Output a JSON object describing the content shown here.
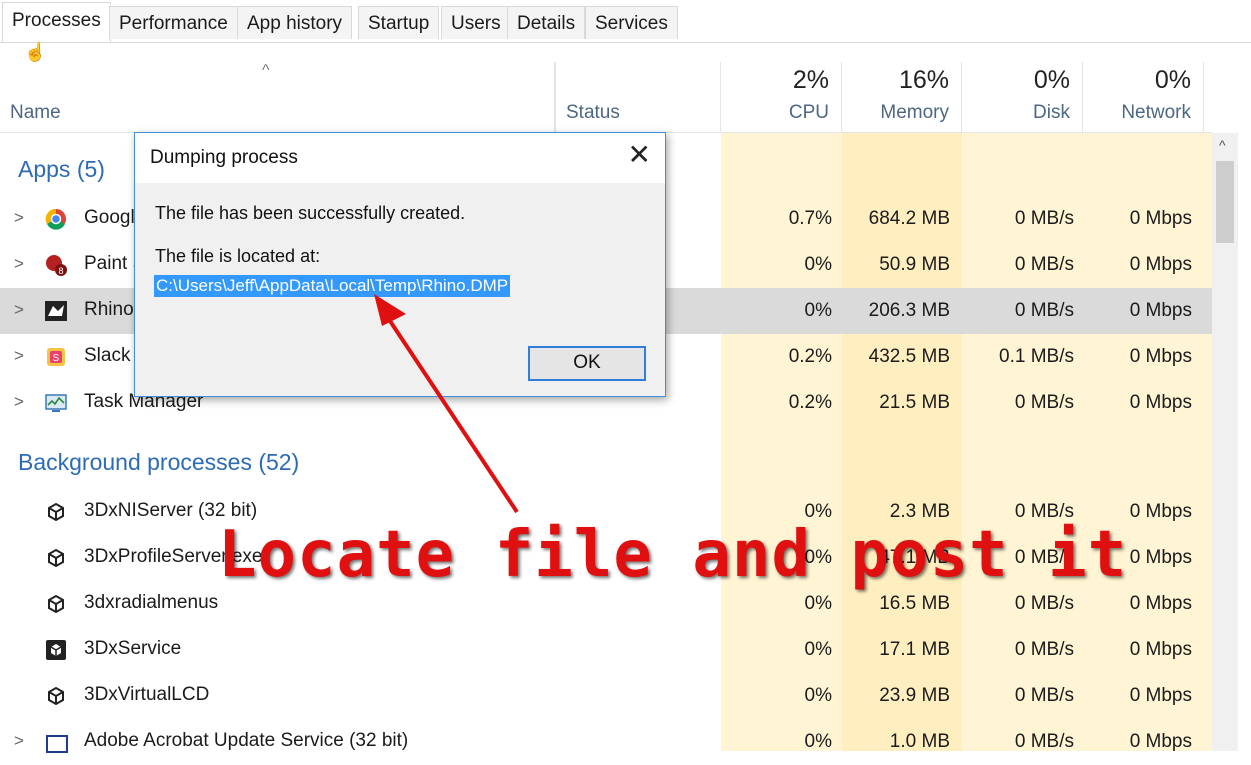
{
  "tabs": [
    "Processes",
    "Performance",
    "App history",
    "Startup",
    "Users",
    "Details",
    "Services"
  ],
  "header": {
    "name_label": "Name",
    "status_label": "Status",
    "cpu_pct": "2%",
    "cpu_label": "CPU",
    "mem_pct": "16%",
    "mem_label": "Memory",
    "disk_pct": "0%",
    "disk_label": "Disk",
    "net_pct": "0%",
    "net_label": "Network"
  },
  "apps_group": "Apps (5)",
  "apps": [
    {
      "name": "Google Chrome",
      "cpu": "0.7%",
      "mem": "684.2 MB",
      "disk": "0 MB/s",
      "net": "0 Mbps",
      "icon": "chrome-icon"
    },
    {
      "name": "Paint Shop Pro",
      "cpu": "0%",
      "mem": "50.9 MB",
      "disk": "0 MB/s",
      "net": "0 Mbps",
      "icon": "paint-icon"
    },
    {
      "name": "Rhinoceros",
      "cpu": "0%",
      "mem": "206.3 MB",
      "disk": "0 MB/s",
      "net": "0 Mbps",
      "icon": "rhino-icon"
    },
    {
      "name": "Slack",
      "cpu": "0.2%",
      "mem": "432.5 MB",
      "disk": "0.1 MB/s",
      "net": "0 Mbps",
      "icon": "slack-icon"
    },
    {
      "name": "Task Manager",
      "cpu": "0.2%",
      "mem": "21.5 MB",
      "disk": "0 MB/s",
      "net": "0 Mbps",
      "icon": "task-manager-icon"
    }
  ],
  "bg_group": "Background processes (52)",
  "background": [
    {
      "name": "3DxNIServer (32 bit)",
      "cpu": "0%",
      "mem": "2.3 MB",
      "disk": "0 MB/s",
      "net": "0 Mbps"
    },
    {
      "name": "3DxProfileServer.exe",
      "cpu": "0%",
      "mem": "47.1 MB",
      "disk": "0 MB/s",
      "net": "0 Mbps"
    },
    {
      "name": "3dxradialmenus",
      "cpu": "0%",
      "mem": "16.5 MB",
      "disk": "0 MB/s",
      "net": "0 Mbps"
    },
    {
      "name": "3DxService",
      "cpu": "0%",
      "mem": "17.1 MB",
      "disk": "0 MB/s",
      "net": "0 Mbps"
    },
    {
      "name": "3DxVirtualLCD",
      "cpu": "0%",
      "mem": "23.9 MB",
      "disk": "0 MB/s",
      "net": "0 Mbps"
    },
    {
      "name": "Adobe Acrobat Update Service (32 bit)",
      "cpu": "0%",
      "mem": "1.0 MB",
      "disk": "0 MB/s",
      "net": "0 Mbps"
    }
  ],
  "dialog": {
    "title": "Dumping process",
    "message": "The file has been successfully created.",
    "location_label": "The file is located at:",
    "path": "C:\\Users\\Jeff\\AppData\\Local\\Temp\\Rhino.DMP",
    "ok_label": "OK"
  },
  "annotation": "Locate file and post it",
  "colors": {
    "accent": "#2d6bb5",
    "heat_light": "#fff4d3",
    "heat_mid": "#ffefc0",
    "annotation": "#e01010",
    "selection": "#3399ff"
  }
}
